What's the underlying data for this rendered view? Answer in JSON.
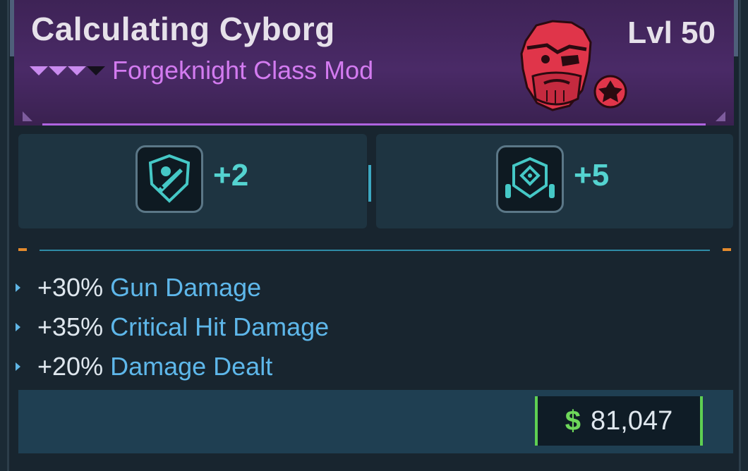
{
  "item": {
    "name": "Calculating Cyborg",
    "class_label": "Forgeknight Class Mod",
    "level_label": "Lvl 50",
    "rarity_colors": [
      "#c98aef",
      "#14101c"
    ],
    "portrait_icon": "bearded-face-icon",
    "class_badge_icon": "forgeknight-badge-icon"
  },
  "skills": [
    {
      "icon": "gun-shield-skill-icon",
      "bonus": "+2"
    },
    {
      "icon": "ammo-grid-skill-icon",
      "bonus": "+5"
    }
  ],
  "stats": [
    {
      "value": "+30%",
      "name": "Gun Damage"
    },
    {
      "value": "+35%",
      "name": "Critical Hit Damage"
    },
    {
      "value": "+20%",
      "name": "Damage Dealt"
    }
  ],
  "price": {
    "symbol": "$",
    "amount": "81,047",
    "accent": "#5ecf52"
  },
  "colors": {
    "header": "#4a2a67",
    "accent_purple": "#b064e0",
    "skill_value": "#54d3d0",
    "stat_name": "#5eb7ea"
  }
}
